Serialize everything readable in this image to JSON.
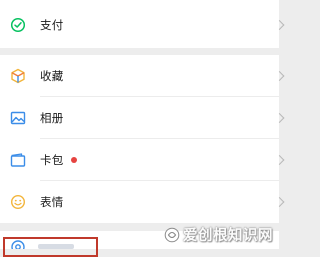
{
  "menu": {
    "pay": {
      "label": "支付",
      "icon": "payment-icon"
    },
    "items": [
      {
        "label": "收藏",
        "icon": "favorites-cube-icon"
      },
      {
        "label": "相册",
        "icon": "album-photo-icon"
      },
      {
        "label": "卡包",
        "icon": "card-wallet-icon",
        "badge": "red-dot"
      },
      {
        "label": "表情",
        "icon": "emoji-smile-icon"
      }
    ]
  },
  "watermark": {
    "text": "爱创根知识网"
  },
  "colors": {
    "page_background": "#ededed",
    "row_background": "#ffffff",
    "pay_icon_green": "#07c160",
    "album_icon_blue": "#3b8de8",
    "card_icon_blue": "#3b8de8",
    "emoji_icon_yellow": "#f3b53b",
    "badge_red": "#e64340",
    "highlight_red": "#c0392b"
  }
}
